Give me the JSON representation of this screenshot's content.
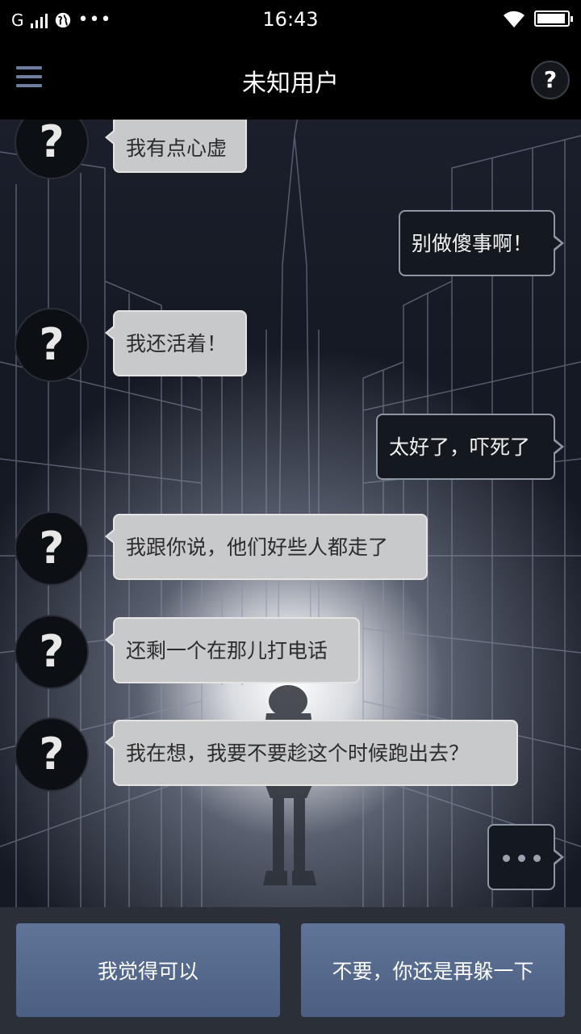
{
  "status_bar": {
    "network": "G",
    "time": "16:43",
    "more": "•••",
    "battery_level": 0.95
  },
  "header": {
    "title": "未知用户",
    "help_icon": "?"
  },
  "avatar_symbol": "?",
  "messages": [
    {
      "side": "in",
      "text": "我有点心虚"
    },
    {
      "side": "out",
      "text": "别做傻事啊！"
    },
    {
      "side": "in",
      "text": "我还活着！"
    },
    {
      "side": "out",
      "text": "太好了，吓死了"
    },
    {
      "side": "in",
      "text": "我跟你说，他们好些人都走了"
    },
    {
      "side": "in",
      "text": "还剩一个在那儿打电话"
    },
    {
      "side": "in",
      "text": "我在想，我要不要趁这个时候跑出去？"
    }
  ],
  "choices": [
    {
      "label": "我觉得可以"
    },
    {
      "label": "不要，你还是再躲一下"
    }
  ],
  "colors": {
    "choice_button": "#566a8e",
    "incoming_bubble": "#c8c9cb",
    "outgoing_bubble": "#14181f"
  }
}
